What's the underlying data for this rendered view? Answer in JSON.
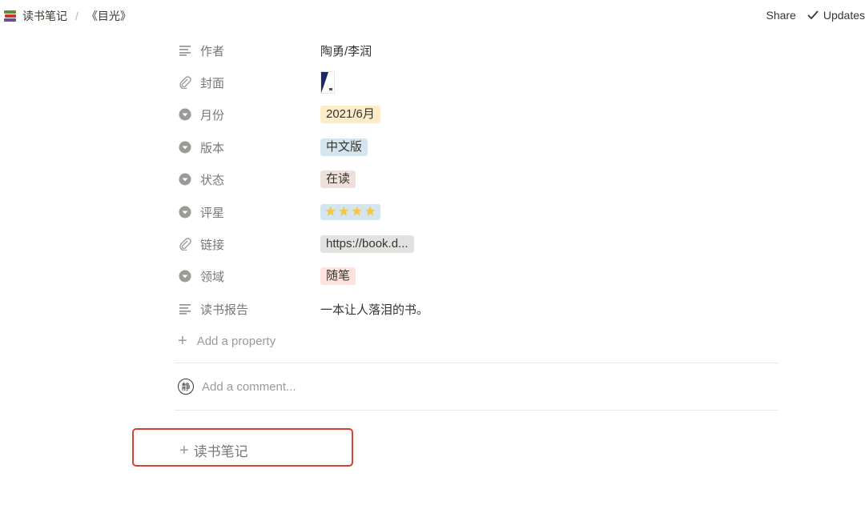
{
  "breadcrumb": {
    "workspace": "读书笔记",
    "separator": "/",
    "page": "《目光》"
  },
  "topbar": {
    "share_label": "Share",
    "updates_label": "Updates"
  },
  "properties": [
    {
      "icon": "text-lines-icon",
      "label": "作者",
      "value": "陶勇/李润"
    },
    {
      "icon": "paperclip-icon",
      "label": "封面",
      "value": ""
    },
    {
      "icon": "select-icon",
      "label": "月份",
      "value": "2021/6月",
      "tag_color": "#fdecc8"
    },
    {
      "icon": "select-icon",
      "label": "版本",
      "value": "中文版",
      "tag_color": "#d3e5ef"
    },
    {
      "icon": "select-icon",
      "label": "状态",
      "value": "在读",
      "tag_color": "#eee0da"
    },
    {
      "icon": "select-icon",
      "label": "评星",
      "value": "⭐⭐⭐⭐",
      "tag_color": "#d3e5ef"
    },
    {
      "icon": "paperclip-icon",
      "label": "链接",
      "value": "https://book.d...",
      "tag_color": "#e3e2e0"
    },
    {
      "icon": "select-icon",
      "label": "领域",
      "value": "随笔",
      "tag_color": "#ffe2dd"
    },
    {
      "icon": "text-lines-icon",
      "label": "读书报告",
      "value": "一本让人落泪的书。"
    }
  ],
  "add_property_label": "Add a property",
  "comment": {
    "avatar_text": "静",
    "placeholder": "Add a comment..."
  },
  "new_page_label": "读书笔记",
  "colors": {
    "highlight_border": "#d9412c",
    "text": "#37352f",
    "muted": "#9b9a97"
  }
}
